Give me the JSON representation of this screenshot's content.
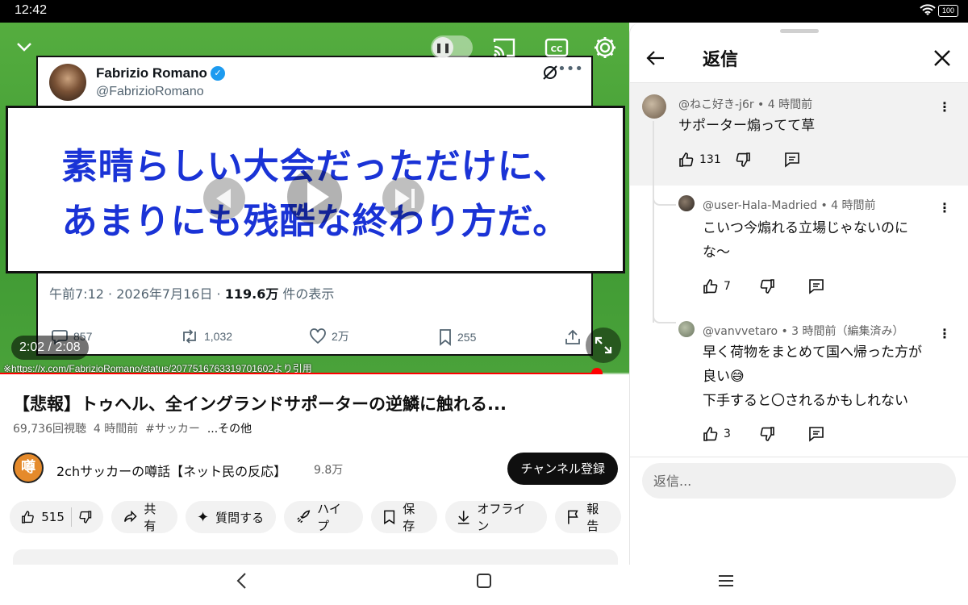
{
  "status_bar": {
    "time": "12:42",
    "battery": "100"
  },
  "video": {
    "tweet": {
      "author_name": "Fabrizio Romano",
      "author_handle": "@FabrizioRomano",
      "timestamp_prefix": "午前7:12 · 2026年7月16日 · ",
      "views_count": "119.6万",
      "views_suffix": " 件の表示",
      "replies": "857",
      "retweets": "1,032",
      "likes": "2万",
      "bookmarks": "255"
    },
    "caption_line1": "素晴らしい大会だっただけに、",
    "caption_line2": "あまりにも残酷な終わり方だ。",
    "time_display": "2:02 / 2:08",
    "source_credit": "※https://x.com/FabrizioRomano/status/2077516763319701602より引用",
    "progress": 0.949
  },
  "info": {
    "title": "【悲報】トゥヘル、全イングランドサポーターの逆鱗に触れる...",
    "views": "69,736回視聴",
    "age": "4 時間前",
    "hashtag": "#サッカー",
    "more": "...その他"
  },
  "channel": {
    "avatar_text": "噂",
    "name": "2chサッカーの噂話【ネット民の反応】",
    "subscribers": "9.8万",
    "subscribe_label": "チャンネル登録"
  },
  "actions": {
    "likes": "515",
    "share": "共有",
    "ask": "質問する",
    "hype": "ハイプ",
    "save": "保存",
    "offline": "オフライン",
    "report": "報告"
  },
  "replies_panel": {
    "title": "返信",
    "reply_placeholder": "返信...",
    "parent": {
      "author": "@ねこ好き-j6r • 4 時間前",
      "text": "サポーター煽ってて草",
      "likes": "131"
    },
    "replies": [
      {
        "author": "@user-Hala-Madried • 4 時間前",
        "text_lines": [
          "こいつ今煽れる立場じゃないのに",
          "な〜"
        ],
        "likes": "7"
      },
      {
        "author": "@vanvvetaro • 3 時間前（編集済み）",
        "text_lines": [
          "早く荷物をまとめて国へ帰った方が",
          "良い😅",
          "下手すると〇されるかもしれない"
        ],
        "likes": "3"
      }
    ]
  }
}
